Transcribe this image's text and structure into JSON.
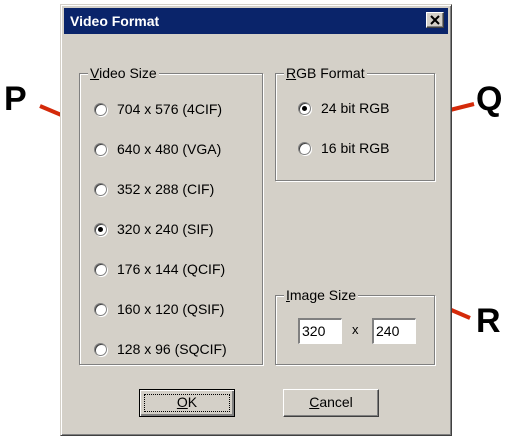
{
  "dialog": {
    "title": "Video Format",
    "close_glyph": "close-icon"
  },
  "video_size": {
    "label_prefix": "",
    "label_access": "V",
    "label_rest": "ideo Size",
    "options": [
      {
        "label": "704 x 576 (4CIF)",
        "checked": false
      },
      {
        "label": "640 x 480 (VGA)",
        "checked": false
      },
      {
        "label": "352 x 288 (CIF)",
        "checked": false
      },
      {
        "label": "320 x 240 (SIF)",
        "checked": true
      },
      {
        "label": "176 x 144 (QCIF)",
        "checked": false
      },
      {
        "label": "160 x 120 (QSIF)",
        "checked": false
      },
      {
        "label": "128 x 96 (SQCIF)",
        "checked": false
      }
    ]
  },
  "rgb_format": {
    "label_access": "R",
    "label_rest": "GB Format",
    "options": [
      {
        "label": "24 bit RGB",
        "checked": true
      },
      {
        "label": "16 bit RGB",
        "checked": false
      }
    ]
  },
  "image_size": {
    "label_access": "I",
    "label_rest": "mage Size",
    "width": "320",
    "times": "x",
    "height": "240"
  },
  "buttons": {
    "ok_access": "O",
    "ok_rest": "K",
    "cancel_access": "C",
    "cancel_rest": "ancel"
  },
  "callouts": {
    "p": "P",
    "q": "Q",
    "r": "R"
  },
  "colors": {
    "face": "#d4d0c8",
    "titlebar": "#0a246a",
    "callout_line": "#d42a0a"
  }
}
